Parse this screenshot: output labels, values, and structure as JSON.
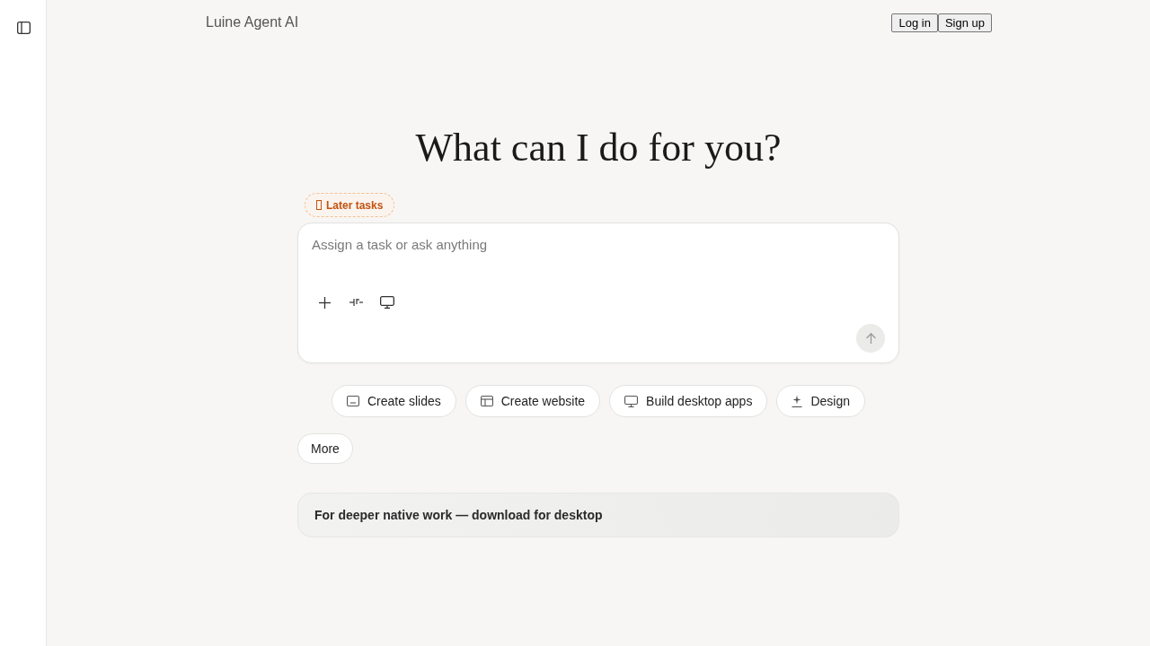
{
  "header": {
    "brand": "Luine Agent AI",
    "buttons": [
      "Log in",
      "Sign up"
    ]
  },
  "hero": {
    "heading": "What can I do for you?"
  },
  "badge": {
    "label": "Later tasks"
  },
  "composer": {
    "placeholder": "Assign a task or ask anything",
    "send_button": {
      "disabled": true
    }
  },
  "quick_actions": [
    {
      "kind": "slides",
      "label": "Create slides"
    },
    {
      "kind": "website",
      "label": "Create website"
    },
    {
      "kind": "desktop",
      "label": "Build desktop apps"
    },
    {
      "kind": "design",
      "label": "Design"
    }
  ],
  "more_button": "More",
  "download_banner": {
    "text": "For deeper native work — download for desktop"
  }
}
